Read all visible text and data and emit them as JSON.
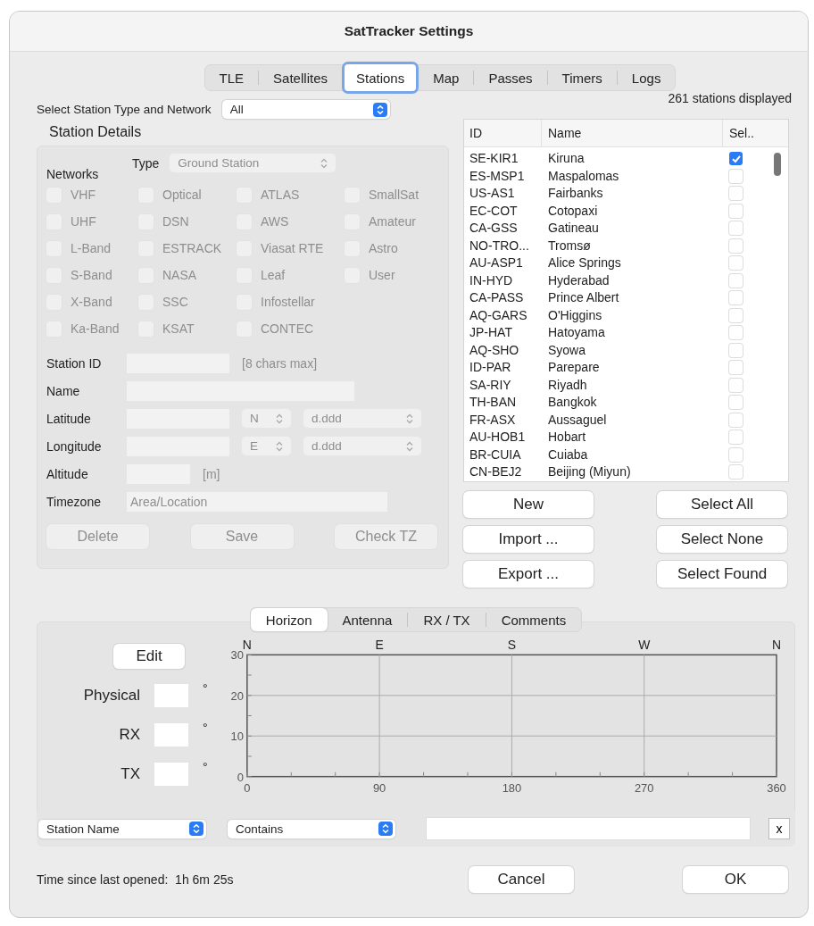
{
  "window": {
    "title": "SatTracker Settings"
  },
  "tabs": [
    {
      "label": "TLE",
      "selected": false
    },
    {
      "label": "Satellites",
      "selected": false
    },
    {
      "label": "Stations",
      "selected": true
    },
    {
      "label": "Map",
      "selected": false
    },
    {
      "label": "Passes",
      "selected": false
    },
    {
      "label": "Timers",
      "selected": false
    },
    {
      "label": "Logs",
      "selected": false
    }
  ],
  "station_filter": {
    "label": "Select Station Type and Network",
    "value": "All"
  },
  "stations_count": "261 stations displayed",
  "station_details": {
    "title": "Station Details",
    "disabled": true,
    "type": {
      "label": "Type",
      "value": "Ground Station"
    },
    "networks_label": "Networks",
    "networks": [
      {
        "label": "VHF",
        "checked": false
      },
      {
        "label": "UHF",
        "checked": false
      },
      {
        "label": "L-Band",
        "checked": false
      },
      {
        "label": "S-Band",
        "checked": false
      },
      {
        "label": "X-Band",
        "checked": false
      },
      {
        "label": "Ka-Band",
        "checked": false
      },
      {
        "label": "Optical",
        "checked": false
      },
      {
        "label": "DSN",
        "checked": false
      },
      {
        "label": "ESTRACK",
        "checked": false
      },
      {
        "label": "NASA",
        "checked": false
      },
      {
        "label": "SSC",
        "checked": false
      },
      {
        "label": "KSAT",
        "checked": false
      },
      {
        "label": "ATLAS",
        "checked": false
      },
      {
        "label": "AWS",
        "checked": false
      },
      {
        "label": "Viasat RTE",
        "checked": false
      },
      {
        "label": "Leaf",
        "checked": false
      },
      {
        "label": "Infostellar",
        "checked": false
      },
      {
        "label": "CONTEC",
        "checked": false
      },
      {
        "label": "SmallSat",
        "checked": false
      },
      {
        "label": "Amateur",
        "checked": false
      },
      {
        "label": "Astro",
        "checked": false
      },
      {
        "label": "User",
        "checked": false
      }
    ],
    "station_id": {
      "label": "Station ID",
      "hint": "[8 chars max]"
    },
    "name": {
      "label": "Name"
    },
    "latitude": {
      "label": "Latitude",
      "hemisphere": "N",
      "format": "d.ddd"
    },
    "longitude": {
      "label": "Longitude",
      "hemisphere": "E",
      "format": "d.ddd"
    },
    "altitude": {
      "label": "Altitude",
      "unit": "[m]"
    },
    "timezone": {
      "label": "Timezone",
      "placeholder": "Area/Location"
    },
    "buttons": [
      "Delete",
      "Save",
      "Check TZ"
    ]
  },
  "table": {
    "columns": [
      "ID",
      "Name",
      "Sel.."
    ],
    "rows": [
      {
        "id": "SE-KIR1",
        "name": "Kiruna",
        "checked": true
      },
      {
        "id": "ES-MSP1",
        "name": "Maspalomas",
        "checked": false
      },
      {
        "id": "US-AS1",
        "name": "Fairbanks",
        "checked": false
      },
      {
        "id": "EC-COT",
        "name": "Cotopaxi",
        "checked": false
      },
      {
        "id": "CA-GSS",
        "name": "Gatineau",
        "checked": false
      },
      {
        "id": "NO-TRO...",
        "name": "Tromsø",
        "checked": false
      },
      {
        "id": "AU-ASP1",
        "name": "Alice Springs",
        "checked": false
      },
      {
        "id": "IN-HYD",
        "name": "Hyderabad",
        "checked": false
      },
      {
        "id": "CA-PASS",
        "name": "Prince Albert",
        "checked": false
      },
      {
        "id": "AQ-GARS",
        "name": "O'Higgins",
        "checked": false
      },
      {
        "id": "JP-HAT",
        "name": "Hatoyama",
        "checked": false
      },
      {
        "id": "AQ-SHO",
        "name": "Syowa",
        "checked": false
      },
      {
        "id": "ID-PAR",
        "name": "Parepare",
        "checked": false
      },
      {
        "id": "SA-RIY",
        "name": "Riyadh",
        "checked": false
      },
      {
        "id": "TH-BAN",
        "name": "Bangkok",
        "checked": false
      },
      {
        "id": "FR-ASX",
        "name": "Aussaguel",
        "checked": false
      },
      {
        "id": "AU-HOB1",
        "name": "Hobart",
        "checked": false
      },
      {
        "id": "BR-CUIA",
        "name": "Cuiaba",
        "checked": false
      },
      {
        "id": "CN-BEJ2",
        "name": "Beijing (Miyun)",
        "checked": false
      }
    ]
  },
  "list_buttons_left": [
    "New",
    "Import ...",
    "Export ..."
  ],
  "list_buttons_right": [
    "Select All",
    "Select None",
    "Select Found"
  ],
  "sub_tabs": [
    {
      "label": "Horizon",
      "selected": true
    },
    {
      "label": "Antenna",
      "selected": false
    },
    {
      "label": "RX / TX",
      "selected": false
    },
    {
      "label": "Comments",
      "selected": false
    }
  ],
  "horizon": {
    "edit_button": "Edit",
    "fields": [
      {
        "label": "Physical",
        "unit": "°"
      },
      {
        "label": "RX",
        "unit": "°"
      },
      {
        "label": "TX",
        "unit": "°"
      }
    ],
    "compass_labels": [
      "N",
      "E",
      "S",
      "W",
      "N"
    ],
    "chart_data": {
      "type": "line",
      "grid": true,
      "xlim": [
        0,
        360
      ],
      "ylim": [
        0,
        30
      ],
      "xticks": [
        0,
        90,
        180,
        270,
        360
      ],
      "yticks": [
        0,
        10,
        20,
        30
      ]
    }
  },
  "search": {
    "field": "Station Name",
    "operator": "Contains",
    "clear": "x"
  },
  "footer": {
    "label": "Time since last opened:",
    "value": "1h 6m 25s",
    "buttons": [
      "Cancel",
      "OK"
    ]
  }
}
